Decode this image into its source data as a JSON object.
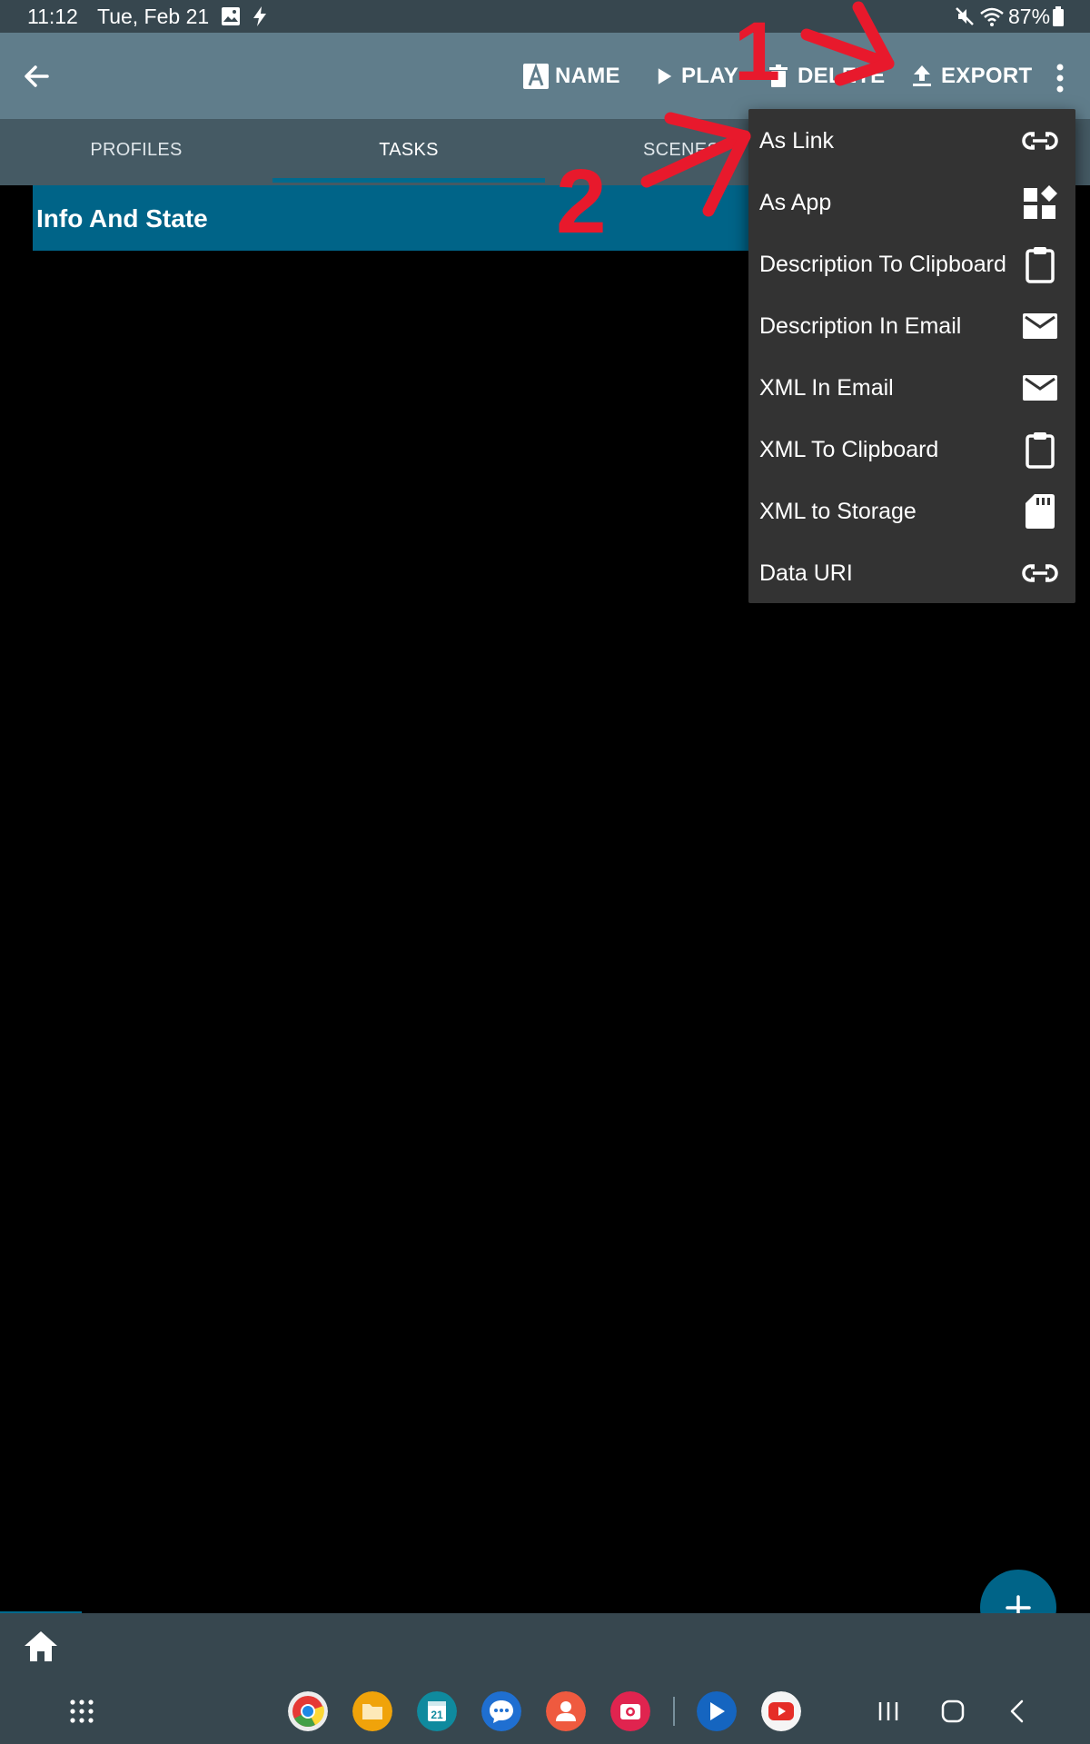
{
  "status_bar": {
    "time": "11:12",
    "date": "Tue, Feb 21",
    "battery": "87%",
    "icons": [
      "gallery-icon",
      "bolt-icon",
      "mute-icon",
      "wifi-icon",
      "battery-icon"
    ]
  },
  "toolbar": {
    "name_label": "NAME",
    "play_label": "PLAY",
    "delete_label": "DELETE",
    "export_label": "EXPORT"
  },
  "tabs": [
    {
      "label": "PROFILES"
    },
    {
      "label": "TASKS"
    },
    {
      "label": "SCENES"
    }
  ],
  "tasks": [
    {
      "name": "Info And State"
    }
  ],
  "export_menu": {
    "items": [
      {
        "label": "As Link",
        "icon": "link-icon"
      },
      {
        "label": "As App",
        "icon": "widgets-icon"
      },
      {
        "label": "Description To Clipboard",
        "icon": "clipboard-icon"
      },
      {
        "label": "Description In Email",
        "icon": "email-icon"
      },
      {
        "label": "XML In Email",
        "icon": "email-icon"
      },
      {
        "label": "XML To Clipboard",
        "icon": "clipboard-icon"
      },
      {
        "label": "XML to Storage",
        "icon": "sd-card-icon"
      },
      {
        "label": "Data URI",
        "icon": "link-icon"
      }
    ]
  },
  "annotations": [
    "1",
    "2"
  ],
  "dock": {
    "apps": [
      "chrome-icon",
      "files-icon",
      "calendar-icon",
      "messages-icon",
      "contacts-icon",
      "camera-icon",
      "tasker-icon",
      "youtube-icon"
    ],
    "calendar_day": "21"
  },
  "colors": {
    "toolbar": "#607d8b",
    "tabs": "#455a64",
    "accent": "#006488",
    "menu": "#333333",
    "annotation": "#e8192c"
  }
}
